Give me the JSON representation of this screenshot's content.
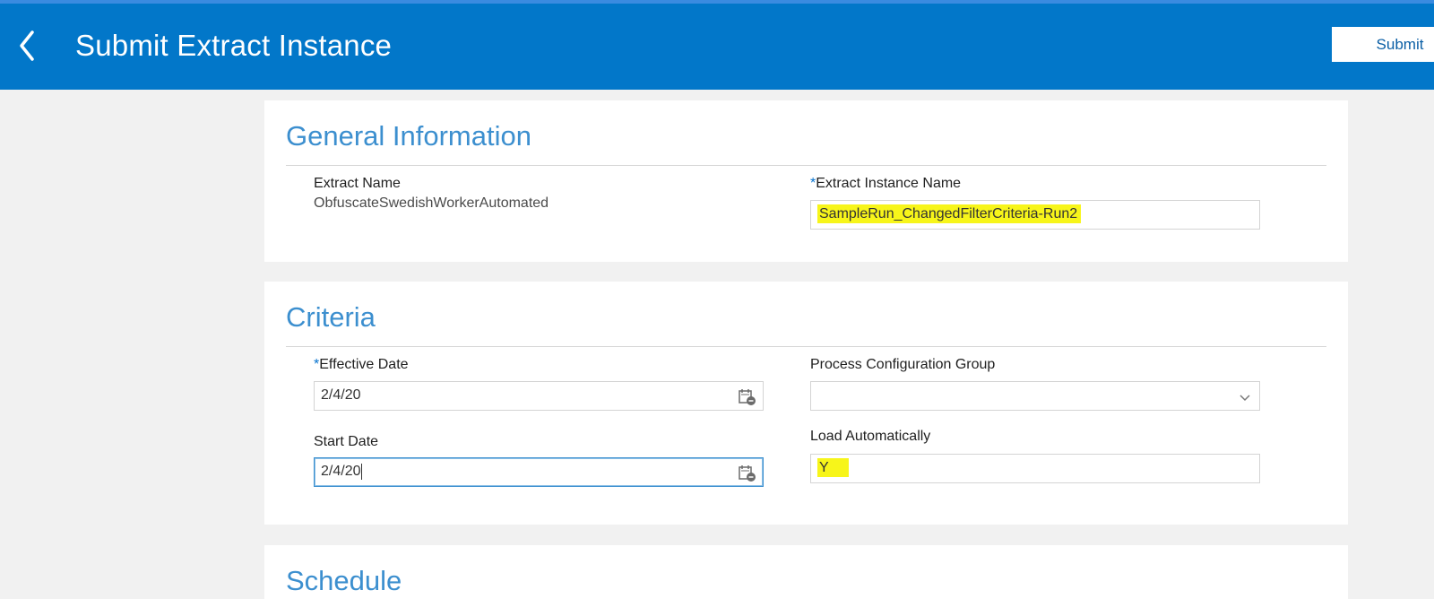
{
  "header": {
    "title": "Submit Extract Instance",
    "submit_label": "Submit",
    "back_icon": "chevron-left-icon"
  },
  "general_information": {
    "title": "General Information",
    "extract_name_label": "Extract Name",
    "extract_name_value": "ObfuscateSwedishWorkerAutomated",
    "instance_name_required": "*",
    "instance_name_label": "Extract Instance Name",
    "instance_name_value": "SampleRun_ChangedFilterCriteria-Run2"
  },
  "criteria": {
    "title": "Criteria",
    "effective_date_required": "*",
    "effective_date_label": "Effective Date",
    "effective_date_value": "2/4/20",
    "process_config_label": "Process Configuration Group",
    "process_config_value": "",
    "start_date_label": "Start Date",
    "start_date_value": "2/4/20",
    "load_auto_label": "Load Automatically",
    "load_auto_value": "Y"
  },
  "schedule": {
    "title": "Schedule"
  },
  "colors": {
    "header_bg": "#0277c9",
    "accent": "#3c8fcf",
    "highlight": "#f7f51a",
    "page_bg": "#f1f1f1"
  }
}
